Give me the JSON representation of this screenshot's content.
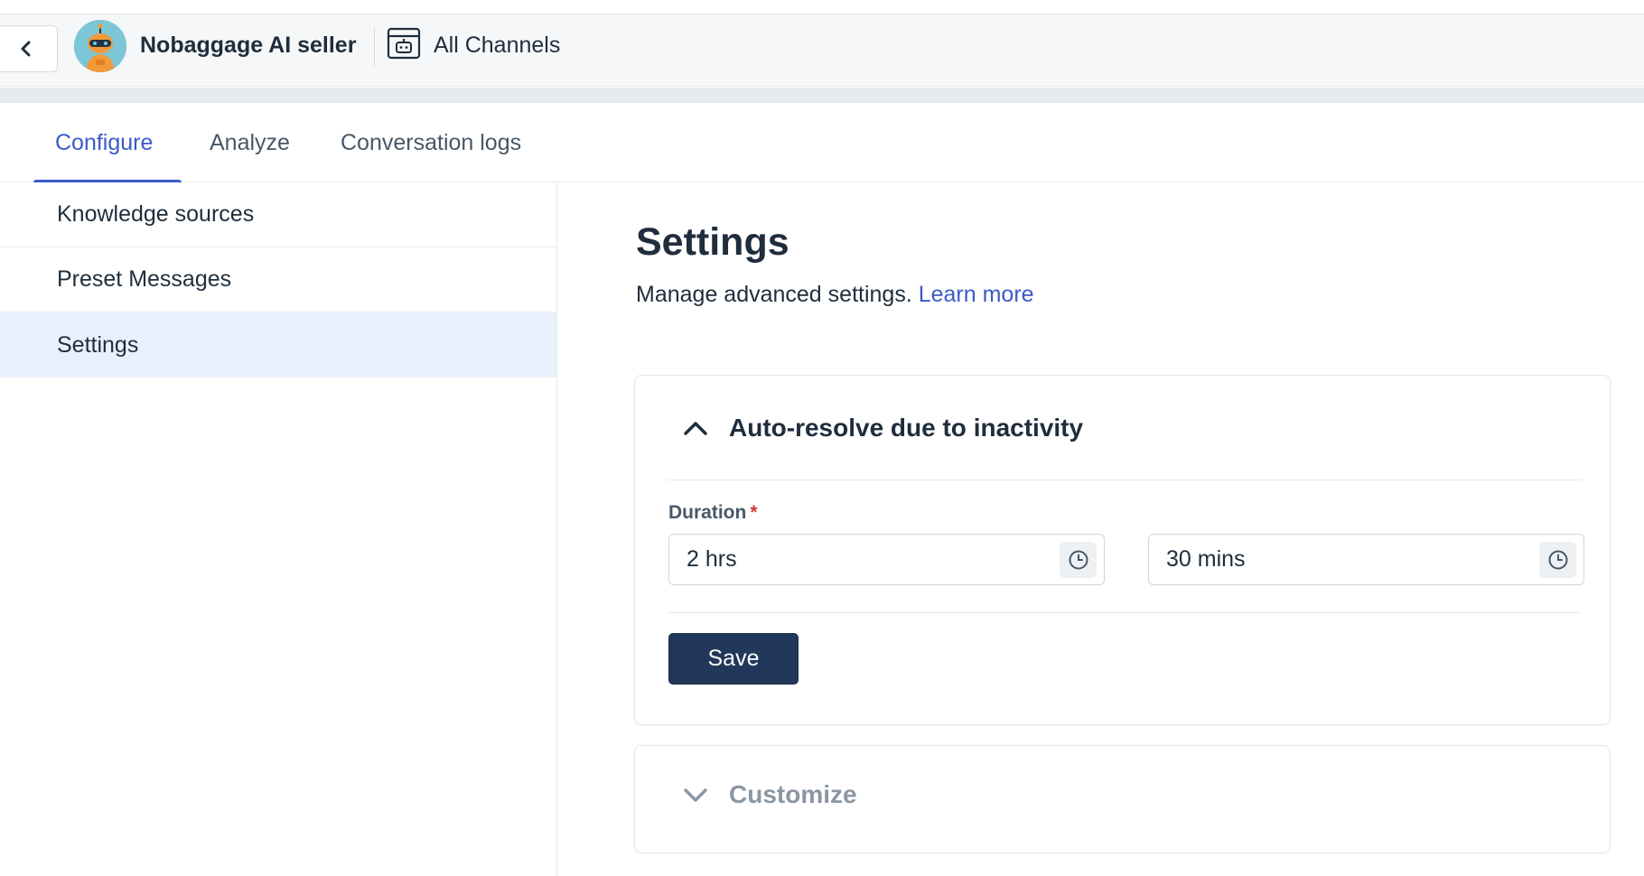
{
  "header": {
    "back_icon": "chevron-left-icon",
    "bot_name": "Nobaggage AI seller",
    "channel_icon": "bot-window-icon",
    "channel_label": "All Channels"
  },
  "tabs": [
    {
      "label": "Configure",
      "active": true
    },
    {
      "label": "Analyze",
      "active": false
    },
    {
      "label": "Conversation logs",
      "active": false
    }
  ],
  "sidebar": {
    "items": [
      {
        "label": "Knowledge sources",
        "active": false
      },
      {
        "label": "Preset Messages",
        "active": false
      },
      {
        "label": "Settings",
        "active": true
      }
    ]
  },
  "main": {
    "title": "Settings",
    "subtitle": "Manage advanced settings.",
    "learn_more": "Learn more",
    "sections": [
      {
        "title": "Auto-resolve due to inactivity",
        "expanded": true,
        "icon": "chevron-up-icon",
        "field_label": "Duration",
        "required_mark": "*",
        "hours_value": "2 hrs",
        "minutes_value": "30 mins",
        "input_icon": "clock-icon",
        "save_label": "Save"
      },
      {
        "title": "Customize",
        "expanded": false,
        "icon": "chevron-down-icon"
      }
    ]
  },
  "colors": {
    "accent": "#3b5bc7",
    "primary_button": "#22385a",
    "active_sidebar": "#e8f1fb",
    "required": "#d6393a"
  }
}
